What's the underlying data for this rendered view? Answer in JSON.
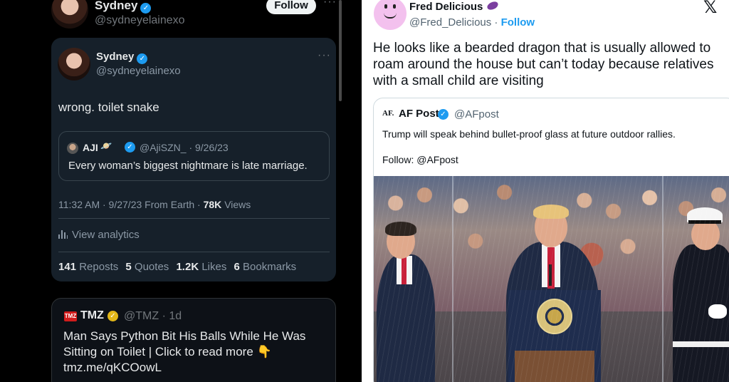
{
  "left_panel": {
    "header": {
      "name": "Sydney",
      "handle": "@sydneyelainexo",
      "follow_label": "Follow",
      "more_label": "···"
    },
    "tweet": {
      "name": "Sydney",
      "handle": "@sydneyelainexo",
      "more_label": "···",
      "text": "wrong. toilet snake",
      "quoted": {
        "name": "AJI",
        "emoji": "🪐",
        "meta": "@AjiSZN_ · 9/26/23",
        "text": "Every woman’s biggest nightmare is late marriage."
      },
      "timestamp": "11:32 AM · 9/27/23 From Earth ·",
      "views_count": "78K",
      "views_label": "Views",
      "analytics_label": "View analytics",
      "stats": {
        "reposts_count": "141",
        "reposts_label": "Reposts",
        "quotes_count": "5",
        "quotes_label": "Quotes",
        "likes_count": "1.2K",
        "likes_label": "Likes",
        "bookmarks_count": "6",
        "bookmarks_label": "Bookmarks"
      }
    },
    "tmz_tweet": {
      "logo_text": "TMZ",
      "name": "TMZ",
      "meta": "@TMZ · 1d",
      "text": "Man Says Python Bit His Balls While He Was Sitting on Toilet  |  Click to read more 👇 tmz.me/qKCOowL"
    }
  },
  "right_panel": {
    "author": {
      "name": "Fred Delicious",
      "handle": "@Fred_Delicious ·",
      "follow_label": "Follow"
    },
    "x_logo": "𝕏",
    "text": "He looks like a bearded dragon that is usually allowed to roam around the house but can’t today because relatives with a small child are visiting",
    "quoted": {
      "logo_text": "AF.",
      "name": "AF Post",
      "handle": "@AFpost",
      "text": "Trump will speak behind bullet-proof glass at future outdoor rallies.",
      "follow_text": "Follow: @AFpost"
    }
  },
  "colors": {
    "dark_bg": "#000000",
    "card_bg": "#16202a",
    "verified_blue": "#1d9bf0",
    "verified_gold": "#e2b719",
    "light_bg": "#ffffff"
  }
}
